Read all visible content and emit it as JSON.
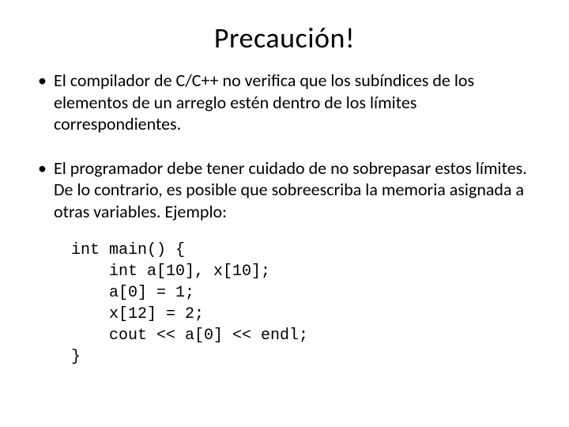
{
  "title": "Precaución!",
  "bullets": {
    "b1": "El compilador de C/C++ no verifica que los subíndices de los elementos de un arreglo estén dentro de los límites correspondientes.",
    "b2": "El programador debe tener cuidado de no sobrepasar estos límites. De lo contrario, es posible que sobreescriba la memoria asignada a otras variables. Ejemplo:"
  },
  "code": "int main() {\n    int a[10], x[10];\n    a[0] = 1;\n    x[12] = 2;\n    cout << a[0] << endl;\n}"
}
